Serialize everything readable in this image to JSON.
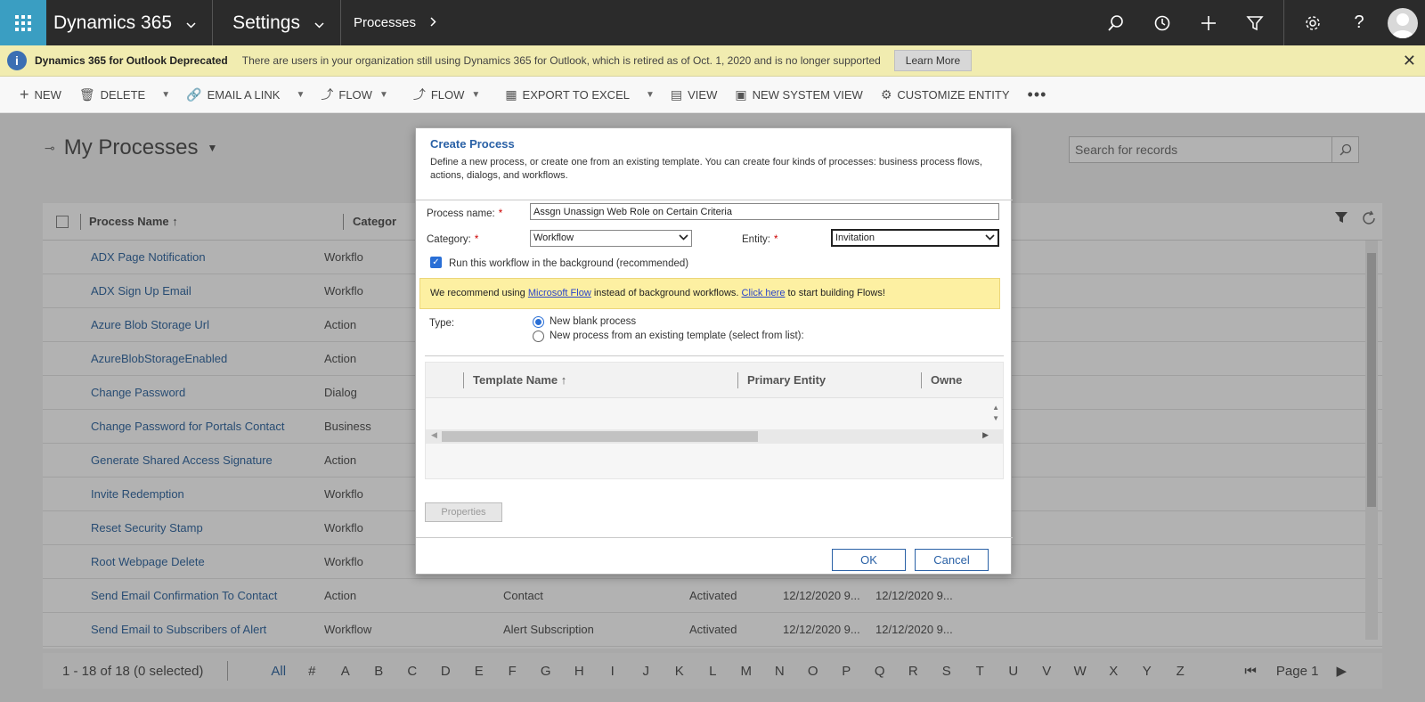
{
  "topnav": {
    "app_title": "Dynamics 365",
    "area": "Settings",
    "breadcrumb": "Processes"
  },
  "banner": {
    "title": "Dynamics 365 for Outlook Deprecated",
    "message": "There are users in your organization still using Dynamics 365 for Outlook, which is retired as of Oct. 1, 2020 and is no longer supported",
    "learn_more": "Learn More"
  },
  "commands": {
    "new": "NEW",
    "delete": "DELETE",
    "email_link": "EMAIL A LINK",
    "flow1": "FLOW",
    "flow2": "FLOW",
    "export": "EXPORT TO EXCEL",
    "view": "VIEW",
    "new_system_view": "NEW SYSTEM VIEW",
    "customize": "CUSTOMIZE ENTITY"
  },
  "view": {
    "title": "My Processes",
    "search_placeholder": "Search for records"
  },
  "grid": {
    "col_name": "Process Name",
    "col_category": "Categor",
    "rows": [
      {
        "name": "ADX Page Notification",
        "category": "Workflo",
        "entity": "",
        "status": "",
        "d1": "",
        "d2": ""
      },
      {
        "name": "ADX Sign Up Email",
        "category": "Workflo",
        "entity": "",
        "status": "",
        "d1": "",
        "d2": ""
      },
      {
        "name": "Azure Blob Storage Url",
        "category": "Action",
        "entity": "",
        "status": "",
        "d1": "",
        "d2": ""
      },
      {
        "name": "AzureBlobStorageEnabled",
        "category": "Action",
        "entity": "",
        "status": "",
        "d1": "",
        "d2": ""
      },
      {
        "name": "Change Password",
        "category": "Dialog",
        "entity": "",
        "status": "",
        "d1": "",
        "d2": ""
      },
      {
        "name": "Change Password for Portals Contact",
        "category": "Business",
        "entity": "",
        "status": "",
        "d1": "",
        "d2": ""
      },
      {
        "name": "Generate Shared Access Signature",
        "category": "Action",
        "entity": "",
        "status": "",
        "d1": "",
        "d2": ""
      },
      {
        "name": "Invite Redemption",
        "category": "Workflo",
        "entity": "",
        "status": "",
        "d1": "",
        "d2": ""
      },
      {
        "name": "Reset Security Stamp",
        "category": "Workflo",
        "entity": "",
        "status": "",
        "d1": "",
        "d2": ""
      },
      {
        "name": "Root Webpage Delete",
        "category": "Workflo",
        "entity": "",
        "status": "",
        "d1": "",
        "d2": ""
      },
      {
        "name": "Send Email Confirmation To Contact",
        "category": "Action",
        "entity": "Contact",
        "status": "Activated",
        "d1": "12/12/2020 9...",
        "d2": "12/12/2020 9..."
      },
      {
        "name": "Send Email to Subscribers of Alert",
        "category": "Workflow",
        "entity": "Alert Subscription",
        "status": "Activated",
        "d1": "12/12/2020 9...",
        "d2": "12/12/2020 9..."
      }
    ]
  },
  "footer": {
    "count": "1 - 18 of 18 (0 selected)",
    "letters": [
      "All",
      "#",
      "A",
      "B",
      "C",
      "D",
      "E",
      "F",
      "G",
      "H",
      "I",
      "J",
      "K",
      "L",
      "M",
      "N",
      "O",
      "P",
      "Q",
      "R",
      "S",
      "T",
      "U",
      "V",
      "W",
      "X",
      "Y",
      "Z"
    ],
    "page": "Page 1"
  },
  "dialog": {
    "title": "Create Process",
    "description": "Define a new process, or create one from an existing template. You can create four kinds of processes: business process flows, actions, dialogs, and workflows.",
    "process_name_label": "Process name:",
    "process_name_value": "Assgn Unassign Web Role on Certain Criteria",
    "category_label": "Category:",
    "category_value": "Workflow",
    "entity_label": "Entity:",
    "entity_value": "Invitation",
    "background_checkbox": "Run this workflow in the background (recommended)",
    "rec_prefix": "We recommend using ",
    "rec_link1": "Microsoft Flow",
    "rec_middle": " instead of background workflows. ",
    "rec_link2": "Click here",
    "rec_suffix": " to start building Flows!",
    "type_label": "Type:",
    "type_option1": "New blank process",
    "type_option2": "New process from an existing template (select from list):",
    "col_template": "Template Name",
    "col_primary": "Primary Entity",
    "col_owner": "Owne",
    "properties": "Properties",
    "ok": "OK",
    "cancel": "Cancel"
  }
}
